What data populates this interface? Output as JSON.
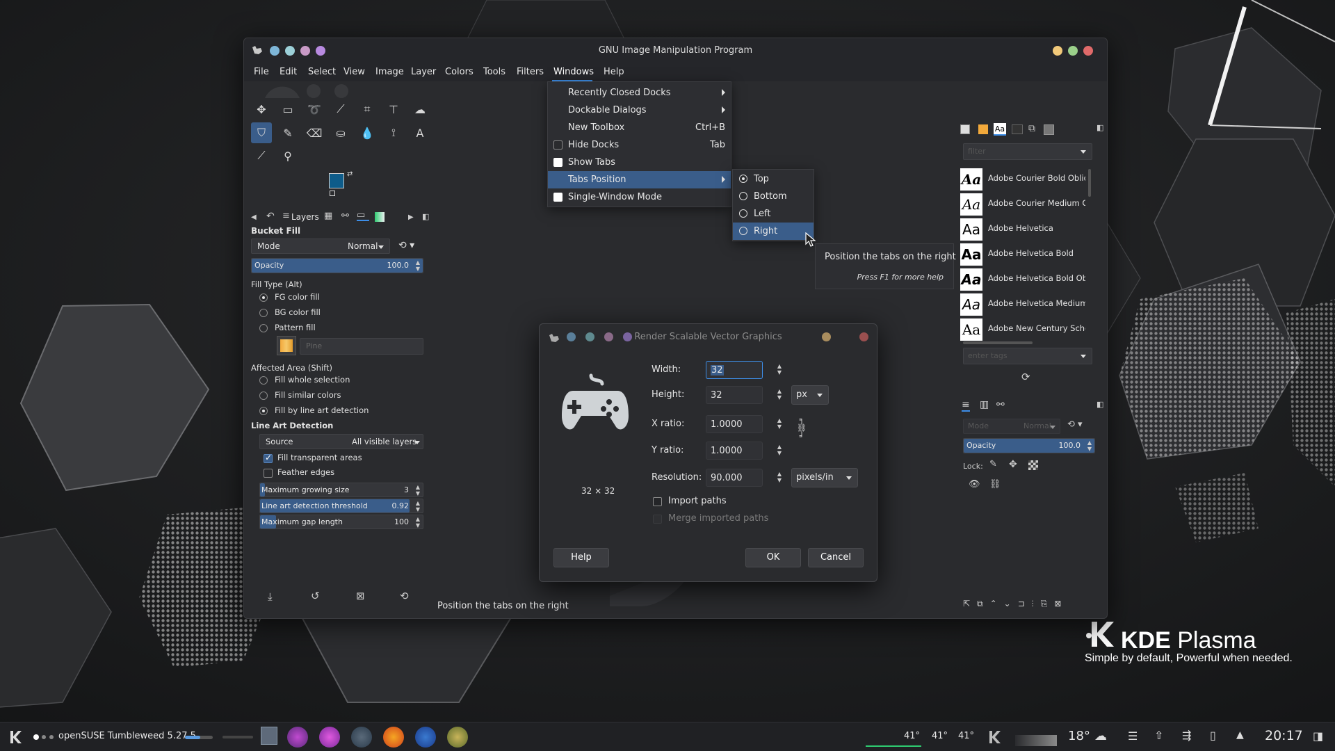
{
  "window": {
    "title": "GNU Image Manipulation Program"
  },
  "menubar": {
    "items": [
      "File",
      "Edit",
      "Select",
      "View",
      "Image",
      "Layer",
      "Colors",
      "Tools",
      "Filters",
      "Windows",
      "Help"
    ],
    "active": "Windows"
  },
  "windows_menu": {
    "items": [
      {
        "label": "Recently Closed Docks",
        "accel": "",
        "submenu": true,
        "check": null
      },
      {
        "label": "Dockable Dialogs",
        "accel": "",
        "submenu": true,
        "check": null
      },
      {
        "label": "New Toolbox",
        "accel": "Ctrl+B",
        "submenu": false,
        "check": null
      },
      {
        "label": "Hide Docks",
        "accel": "Tab",
        "submenu": false,
        "check": false
      },
      {
        "label": "Show Tabs",
        "accel": "",
        "submenu": false,
        "check": true
      },
      {
        "label": "Tabs Position",
        "accel": "",
        "submenu": true,
        "check": null,
        "highlighted": true
      },
      {
        "label": "Single-Window Mode",
        "accel": "",
        "submenu": false,
        "check": true
      }
    ]
  },
  "tabs_position_menu": {
    "items": [
      {
        "label": "Top",
        "selected": true
      },
      {
        "label": "Bottom",
        "selected": false
      },
      {
        "label": "Left",
        "selected": false
      },
      {
        "label": "Right",
        "selected": false,
        "highlighted": true
      }
    ]
  },
  "tooltip": {
    "text": "Position the tabs on the right",
    "help": "Press F1 for more help"
  },
  "tool_options": {
    "tab_label": "Layers",
    "title": "Bucket Fill",
    "mode_label": "Mode",
    "mode_value": "Normal",
    "opacity_label": "Opacity",
    "opacity_value": "100.0",
    "opacity_level": 1.0,
    "fill_type_label": "Fill Type  (Alt)",
    "fill_types": [
      {
        "label": "FG color fill",
        "selected": true
      },
      {
        "label": "BG color fill",
        "selected": false
      },
      {
        "label": "Pattern fill",
        "selected": false
      }
    ],
    "pattern_name": "Pine",
    "affected_area_label": "Affected Area  (Shift)",
    "affected_areas": [
      {
        "label": "Fill whole selection",
        "selected": false
      },
      {
        "label": "Fill similar colors",
        "selected": false
      },
      {
        "label": "Fill by line art detection",
        "selected": true
      }
    ],
    "line_art_label": "Line Art Detection",
    "source_label": "Source",
    "source_value": "All visible layers",
    "fill_transparent_label": "Fill transparent areas",
    "fill_transparent": true,
    "feather_label": "Feather edges",
    "feather": false,
    "max_growing_label": "Maximum growing size",
    "max_growing_value": "3",
    "max_growing_level": 0.03,
    "threshold_label": "Line art detection threshold",
    "threshold_value": "0.92",
    "threshold_level": 0.92,
    "max_gap_label": "Maximum gap length",
    "max_gap_value": "100",
    "max_gap_level": 0.1
  },
  "status_bar": {
    "text": "Position the tabs on the right"
  },
  "fonts_panel": {
    "filter_placeholder": "filter",
    "fonts": [
      {
        "glyph": "Aa",
        "name": "Adobe Courier Bold Obliqu"
      },
      {
        "glyph": "Aa",
        "name": "Adobe Courier Medium Obl"
      },
      {
        "glyph": "Aa",
        "name": "Adobe Helvetica"
      },
      {
        "glyph": "Aa",
        "name": "Adobe Helvetica Bold"
      },
      {
        "glyph": "Aa",
        "name": "Adobe Helvetica Bold Oblic"
      },
      {
        "glyph": "Aa",
        "name": "Adobe Helvetica Medium O"
      },
      {
        "glyph": "Aa",
        "name": "Adobe New Century School"
      }
    ],
    "tags_placeholder": "enter tags"
  },
  "layers_panel": {
    "mode_label": "Mode",
    "mode_value": "Normal",
    "opacity_label": "Opacity",
    "opacity_value": "100.0",
    "lock_label": "Lock:"
  },
  "svg_dialog": {
    "title": "Render Scalable Vector Graphics",
    "preview_size": "32 × 32",
    "width_label": "Width:",
    "width_value": "32",
    "height_label": "Height:",
    "height_value": "32",
    "unit": "px",
    "xratio_label": "X ratio:",
    "xratio_value": "1.0000",
    "yratio_label": "Y ratio:",
    "yratio_value": "1.0000",
    "resolution_label": "Resolution:",
    "resolution_value": "90.000",
    "resolution_unit": "pixels/in",
    "import_paths_label": "Import paths",
    "merge_paths_label": "Merge imported paths",
    "help_label": "Help",
    "ok_label": "OK",
    "cancel_label": "Cancel"
  },
  "desktop": {
    "brand_title_bold": "KDE",
    "brand_title_rest": " Plasma",
    "brand_subtitle": "Simple by default, Powerful when  needed."
  },
  "taskbar": {
    "activity_label": "openSUSE Tumbleweed 5.27.5",
    "temps": [
      "41°",
      "41°",
      "41°"
    ],
    "weather": "18°",
    "clock": "20:17"
  },
  "colors": {
    "accent": "#3a5d8a",
    "fg_color": "#0e5c8a",
    "bg_color": "#ffffff"
  }
}
